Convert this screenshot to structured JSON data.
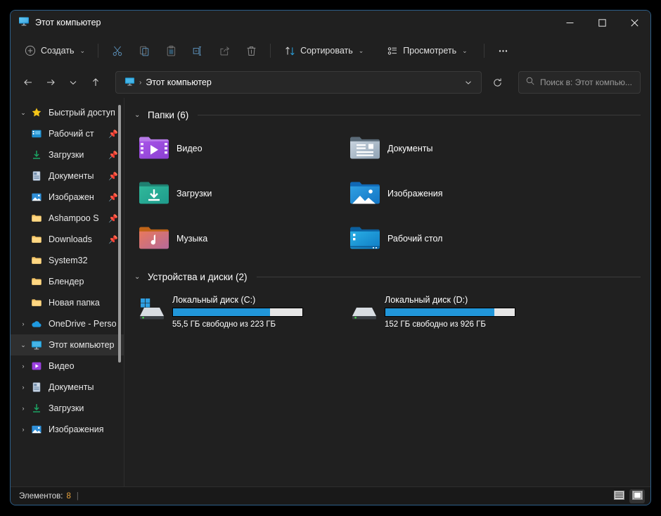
{
  "window": {
    "title": "Этот компьютер",
    "title_icon": "this-pc-icon",
    "accent_color": "#2196d9",
    "background": "#202020",
    "controls": {
      "minimize": "—",
      "maximize": "▢",
      "close": "✕"
    }
  },
  "toolbar": {
    "new_label": "Создать",
    "cut_label": "Вырезать",
    "copy_label": "Копировать",
    "paste_label": "Вставить",
    "rename_label": "Переименовать",
    "share_label": "Поделиться",
    "delete_label": "Удалить",
    "sort_label": "Сортировать",
    "view_label": "Просмотреть",
    "more_label": "Подробнее"
  },
  "addressbar": {
    "back_label": "Назад",
    "forward_label": "Вперёд",
    "recent_label": "Последние расположения",
    "up_label": "Вверх",
    "crumb_icon": "this-pc-icon",
    "crumb_text": "Этот компьютер",
    "crumb_separator": "›",
    "dropdown_label": "Предыдущие расположения",
    "refresh_label": "Обновить"
  },
  "search": {
    "placeholder": "Поиск в: Этот компью...",
    "value": "",
    "icon": "search-icon"
  },
  "sidebar": {
    "items": [
      {
        "label": "Быстрый доступ",
        "icon": "star-icon",
        "level": 0,
        "expander": "chevron-down-icon",
        "pinned": false,
        "selected": false
      },
      {
        "label": "Рабочий ст",
        "icon": "desktop-folder-icon",
        "level": 1,
        "expander": "",
        "pinned": true,
        "selected": false
      },
      {
        "label": "Загрузки",
        "icon": "downloads-icon",
        "level": 1,
        "expander": "",
        "pinned": true,
        "selected": false
      },
      {
        "label": "Документы",
        "icon": "documents-icon",
        "level": 1,
        "expander": "",
        "pinned": true,
        "selected": false
      },
      {
        "label": "Изображен",
        "icon": "pictures-icon",
        "level": 1,
        "expander": "",
        "pinned": true,
        "selected": false
      },
      {
        "label": "Ashampoo S",
        "icon": "folder-icon",
        "level": 1,
        "expander": "",
        "pinned": true,
        "selected": false
      },
      {
        "label": "Downloads",
        "icon": "folder-icon",
        "level": 1,
        "expander": "",
        "pinned": true,
        "selected": false
      },
      {
        "label": "System32",
        "icon": "folder-icon",
        "level": 1,
        "expander": "",
        "pinned": false,
        "selected": false
      },
      {
        "label": "Блендер",
        "icon": "folder-icon",
        "level": 1,
        "expander": "",
        "pinned": false,
        "selected": false
      },
      {
        "label": "Новая папка",
        "icon": "folder-icon",
        "level": 1,
        "expander": "",
        "pinned": false,
        "selected": false
      },
      {
        "label": "OneDrive - Perso",
        "icon": "onedrive-icon",
        "level": 0,
        "expander": "chevron-right-icon",
        "pinned": false,
        "selected": false
      },
      {
        "label": "Этот компьютер",
        "icon": "this-pc-icon",
        "level": 0,
        "expander": "chevron-down-icon",
        "pinned": false,
        "selected": true
      },
      {
        "label": "Видео",
        "icon": "videos-icon",
        "level": 2,
        "expander": "chevron-right-icon",
        "pinned": false,
        "selected": false
      },
      {
        "label": "Документы",
        "icon": "documents-icon",
        "level": 2,
        "expander": "chevron-right-icon",
        "pinned": false,
        "selected": false
      },
      {
        "label": "Загрузки",
        "icon": "downloads-icon",
        "level": 2,
        "expander": "chevron-right-icon",
        "pinned": false,
        "selected": false
      },
      {
        "label": "Изображения",
        "icon": "pictures-icon",
        "level": 2,
        "expander": "chevron-right-icon",
        "pinned": false,
        "selected": false
      }
    ]
  },
  "content": {
    "folders_group": {
      "title": "Папки (6)",
      "chevron": "chevron-down-icon"
    },
    "folders": [
      {
        "name": "Видео",
        "icon": "videos-folder-icon"
      },
      {
        "name": "Документы",
        "icon": "documents-folder-icon"
      },
      {
        "name": "Загрузки",
        "icon": "downloads-folder-icon"
      },
      {
        "name": "Изображения",
        "icon": "pictures-folder-icon"
      },
      {
        "name": "Музыка",
        "icon": "music-folder-icon"
      },
      {
        "name": "Рабочий стол",
        "icon": "desktop-folder-icon"
      }
    ],
    "drives_group": {
      "title": "Устройства и диски (2)",
      "chevron": "chevron-down-icon"
    },
    "drives": [
      {
        "name": "Локальный диск (C:)",
        "free_text": "55,5 ГБ свободно из 223 ГБ",
        "used_percent": 75,
        "icon": "windows-drive-icon",
        "bar_fill_color": "#2196d9",
        "bar_track_color": "#e6e6e6"
      },
      {
        "name": "Локальный диск (D:)",
        "free_text": "152 ГБ свободно из 926 ГБ",
        "used_percent": 84,
        "icon": "drive-icon",
        "bar_fill_color": "#2196d9",
        "bar_track_color": "#e6e6e6"
      }
    ]
  },
  "statusbar": {
    "items_label": "Элементов:",
    "items_count": "8",
    "divider": "|",
    "details_view_label": "Таблица",
    "details_view_icon": "details-view-icon",
    "large_icons_view_label": "Крупные значки",
    "large_icons_view_icon": "large-icons-view-icon"
  }
}
